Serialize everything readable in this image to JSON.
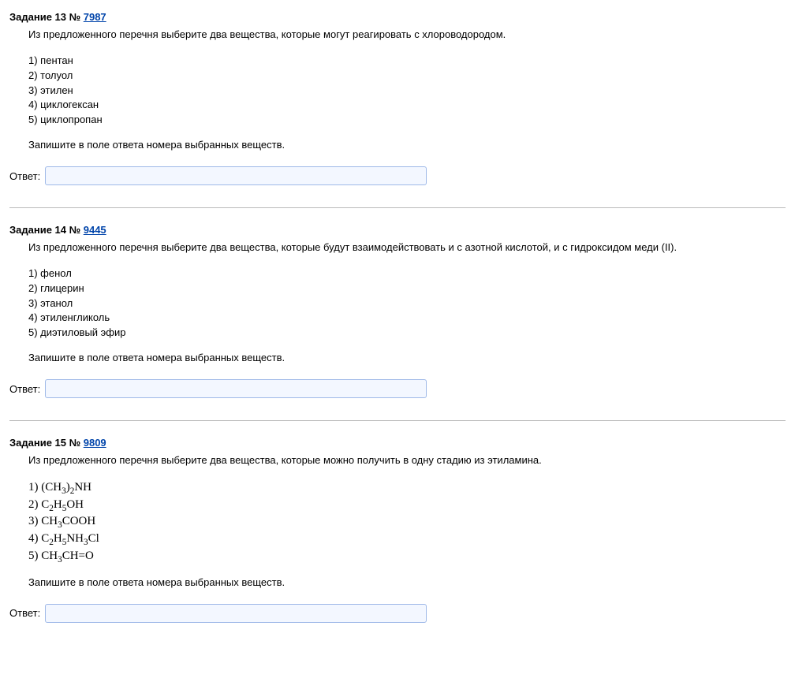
{
  "tasks": [
    {
      "label_prefix": "Задание 13 №",
      "task_id": "7987",
      "prompt": "Из предложенного перечня выберите два вещества, которые могут реагировать с хлороводородом.",
      "options": [
        "1) пентан",
        "2) толуол",
        "3) этилен",
        "4) циклогексан",
        "5) циклопропан"
      ],
      "instruction": "Запишите в поле ответа номера выбранных веществ.",
      "answer_label": "Ответ:",
      "answer_value": ""
    },
    {
      "label_prefix": "Задание 14 №",
      "task_id": "9445",
      "prompt": "Из предложенного перечня выберите два вещества, которые будут взаимодействовать и с азотной кислотой, и с гидроксидом меди (II).",
      "options": [
        "1) фенол",
        "2) глицерин",
        "3) этанол",
        "4) этиленгликоль",
        "5) диэтиловый эфир"
      ],
      "instruction": "Запишите в поле ответа номера выбранных веществ.",
      "answer_label": "Ответ:",
      "answer_value": ""
    },
    {
      "label_prefix": "Задание 15 №",
      "task_id": "9809",
      "prompt": "Из предложенного перечня выберите два вещества, которые можно получить в одну стадию из этиламина.",
      "options_html": [
        "1) (CH<sub>3</sub>)<sub>2</sub>NH",
        "2) C<sub>2</sub>H<sub>5</sub>OH",
        "3) CH<sub>3</sub>COOH",
        "4) C<sub>2</sub>H<sub>5</sub>NH<sub>3</sub>Cl",
        "5) CH<sub>3</sub>CH=O"
      ],
      "instruction": "Запишите в поле ответа номера выбранных веществ.",
      "answer_label": "Ответ:",
      "answer_value": ""
    }
  ]
}
